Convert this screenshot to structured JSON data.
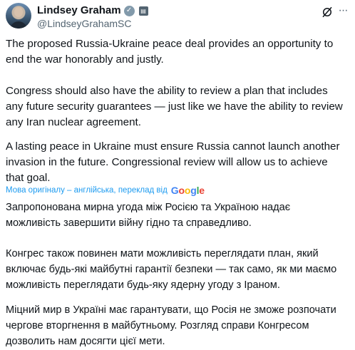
{
  "author": {
    "name": "Lindsey Graham",
    "handle": "@LindseyGrahamSC"
  },
  "post": {
    "paragraphs": [
      "The proposed Russia-Ukraine peace deal provides an opportunity to end the war honorably and justly.",
      "Congress should also have the ability to review a plan that  includes any future security guarantees — just like we have the ability to review any Iran nuclear agreement.",
      "A lasting peace in Ukraine must ensure Russia cannot launch another invasion in the future. Congressional review will allow us to achieve that goal."
    ]
  },
  "translation": {
    "notice": "Мова оригіналу – англійська, переклад від",
    "provider": "Google",
    "paragraphs": [
      "Запропонована мирна угода між Росією та Україною надає можливість завершити війну гідно та справедливо.",
      "Конгрес також повинен мати можливість переглядати план, який включає будь-які майбутні гарантії безпеки — так само, як ми маємо можливість переглядати будь-яку ядерну угоду з Іраном.",
      "Міцний мир в Україні має гарантувати, що Росія не зможе розпочати чергове вторгнення в майбутньому. Розгляд справи Конгресом дозволить нам досягти цієї мети."
    ]
  },
  "icons": {
    "verified": "verified-badge-icon",
    "government": "government-account-icon",
    "grok": "grok-icon",
    "more": "more-icon"
  },
  "colors": {
    "text": "#0f1419",
    "secondary": "#536471",
    "link": "#1d9bf0",
    "verified_badge": "#829aab"
  }
}
